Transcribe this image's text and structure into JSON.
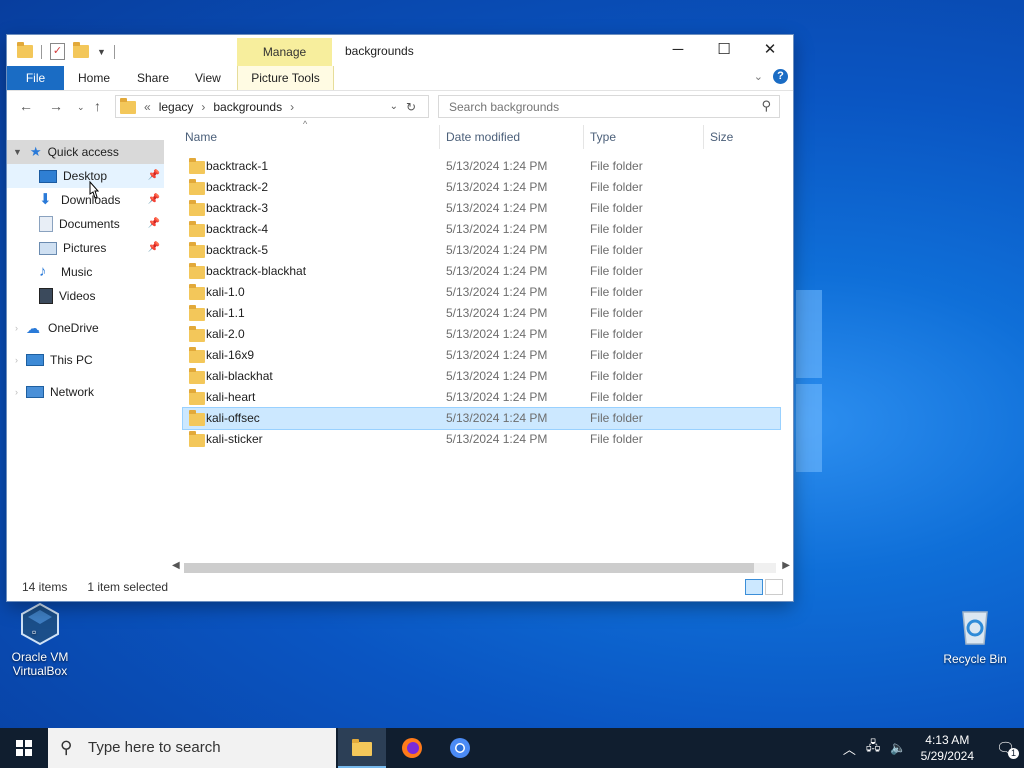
{
  "desktop": {
    "icons": [
      {
        "label": "Oracle VM\nVirtualBox"
      },
      {
        "label": "Recycle Bin"
      }
    ]
  },
  "window": {
    "title": "backgrounds",
    "context_tab_group": "Manage",
    "tabs": [
      "File",
      "Home",
      "Share",
      "View",
      "Picture Tools"
    ],
    "address": {
      "overflow": "«",
      "segments": [
        "legacy",
        "backgrounds"
      ]
    },
    "search_placeholder": "Search backgrounds",
    "nav": {
      "quick_access": "Quick access",
      "items": [
        "Desktop",
        "Downloads",
        "Documents",
        "Pictures",
        "Music",
        "Videos"
      ],
      "onedrive": "OneDrive",
      "this_pc": "This PC",
      "network": "Network"
    },
    "columns": [
      "Name",
      "Date modified",
      "Type",
      "Size"
    ],
    "files": [
      {
        "name": "backtrack-1",
        "date": "5/13/2024 1:24 PM",
        "type": "File folder"
      },
      {
        "name": "backtrack-2",
        "date": "5/13/2024 1:24 PM",
        "type": "File folder"
      },
      {
        "name": "backtrack-3",
        "date": "5/13/2024 1:24 PM",
        "type": "File folder"
      },
      {
        "name": "backtrack-4",
        "date": "5/13/2024 1:24 PM",
        "type": "File folder"
      },
      {
        "name": "backtrack-5",
        "date": "5/13/2024 1:24 PM",
        "type": "File folder"
      },
      {
        "name": "backtrack-blackhat",
        "date": "5/13/2024 1:24 PM",
        "type": "File folder"
      },
      {
        "name": "kali-1.0",
        "date": "5/13/2024 1:24 PM",
        "type": "File folder"
      },
      {
        "name": "kali-1.1",
        "date": "5/13/2024 1:24 PM",
        "type": "File folder"
      },
      {
        "name": "kali-2.0",
        "date": "5/13/2024 1:24 PM",
        "type": "File folder"
      },
      {
        "name": "kali-16x9",
        "date": "5/13/2024 1:24 PM",
        "type": "File folder"
      },
      {
        "name": "kali-blackhat",
        "date": "5/13/2024 1:24 PM",
        "type": "File folder"
      },
      {
        "name": "kali-heart",
        "date": "5/13/2024 1:24 PM",
        "type": "File folder"
      },
      {
        "name": "kali-offsec",
        "date": "5/13/2024 1:24 PM",
        "type": "File folder",
        "selected": true
      },
      {
        "name": "kali-sticker",
        "date": "5/13/2024 1:24 PM",
        "type": "File folder"
      }
    ],
    "status": {
      "count": "14 items",
      "selection": "1 item selected"
    }
  },
  "taskbar": {
    "search_placeholder": "Type here to search",
    "time": "4:13 AM",
    "date": "5/29/2024",
    "notifications": "1"
  }
}
